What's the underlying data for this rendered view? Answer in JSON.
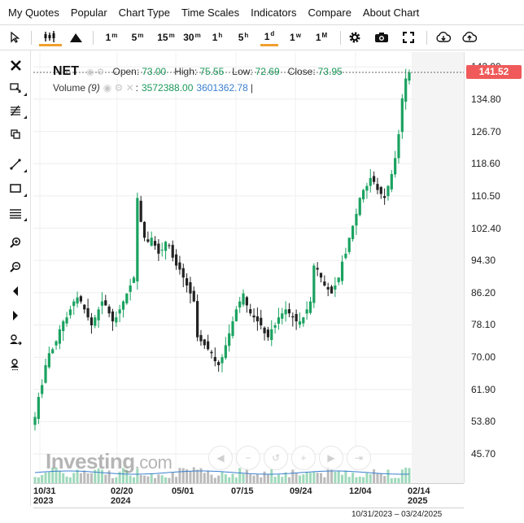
{
  "menu": [
    "My Quotes",
    "Popular",
    "Chart Type",
    "Time Scales",
    "Indicators",
    "Compare",
    "About Chart"
  ],
  "toolbar": {
    "timeframes": [
      {
        "label": "1",
        "unit": "m"
      },
      {
        "label": "5",
        "unit": "m"
      },
      {
        "label": "15",
        "unit": "m"
      },
      {
        "label": "30",
        "unit": "m"
      },
      {
        "label": "1",
        "unit": "h"
      },
      {
        "label": "5",
        "unit": "h"
      },
      {
        "label": "1",
        "unit": "d"
      },
      {
        "label": "1",
        "unit": "w"
      },
      {
        "label": "1",
        "unit": "M"
      }
    ],
    "active_timeframe": "1d",
    "icons": [
      "cursor-icon",
      "candlestick-icon",
      "mountain-icon",
      "gear-icon",
      "camera-icon",
      "fullscreen-icon",
      "download-icon",
      "upload-icon"
    ]
  },
  "left_tools": [
    "close-icon",
    "crosshair-icon",
    "fib-icon",
    "clone-icon",
    "trendline-icon",
    "rectangle-icon",
    "lines-icon",
    "zoom-in-icon",
    "zoom-out-icon",
    "scroll-left-icon",
    "scroll-right-icon",
    "user-add-icon",
    "user-remove-icon"
  ],
  "legend": {
    "symbol": "NET",
    "open_label": "Open:",
    "open": "73.00",
    "high_label": "High:",
    "high": "75.55",
    "low_label": "Low:",
    "low": "72.69",
    "close_label": "Close:",
    "close": "73.95",
    "volume_label": "Volume",
    "volume_param": "(9)",
    "volume_value": "3572388.00",
    "volume_ma": "3601362.78"
  },
  "current_price": "141.52",
  "range_text": "10/31/2023 – 03/24/2025",
  "watermark": {
    "brand": "Investing",
    "suffix": ".com"
  },
  "colors": {
    "up": "#1aa260",
    "down": "#222222",
    "price_tag": "#f05a5a",
    "volume_ma": "#3a7fd0"
  },
  "chart_data": {
    "type": "candlestick",
    "y_ticks": [
      "142.90",
      "134.80",
      "126.70",
      "118.60",
      "110.50",
      "102.40",
      "94.30",
      "86.20",
      "78.10",
      "70.00",
      "61.90",
      "53.80",
      "45.70"
    ],
    "ylim": [
      40,
      145
    ],
    "x_ticks": [
      {
        "top": "10/31",
        "bottom": "2023"
      },
      {
        "top": "02/20",
        "bottom": "2024"
      },
      {
        "top": "05/01",
        "bottom": ""
      },
      {
        "top": "07/15",
        "bottom": ""
      },
      {
        "top": "09/24",
        "bottom": ""
      },
      {
        "top": "12/04",
        "bottom": ""
      },
      {
        "top": "02/14",
        "bottom": "2025"
      }
    ],
    "close_series": [
      55,
      60,
      63,
      68,
      71,
      72,
      74,
      77,
      79,
      80,
      82,
      84,
      85,
      84,
      82,
      80,
      78,
      80,
      82,
      84,
      83,
      81,
      79,
      80,
      82,
      84,
      86,
      88,
      90,
      110,
      104,
      100,
      99,
      100,
      98,
      96,
      97,
      99,
      98,
      95,
      93,
      92,
      90,
      88,
      86,
      84,
      75,
      74,
      73,
      72,
      71,
      69,
      68,
      70,
      73,
      76,
      79,
      82,
      84,
      86,
      83,
      81,
      80,
      79,
      78,
      76,
      75,
      77,
      78,
      80,
      81,
      82,
      81,
      80,
      79,
      79,
      80,
      82,
      84,
      93,
      92,
      90,
      88,
      87,
      86,
      88,
      90,
      94,
      96,
      100,
      103,
      106,
      110,
      112,
      113,
      115,
      114,
      112,
      111,
      110,
      113,
      116,
      120,
      126,
      135,
      140,
      141.52
    ]
  }
}
